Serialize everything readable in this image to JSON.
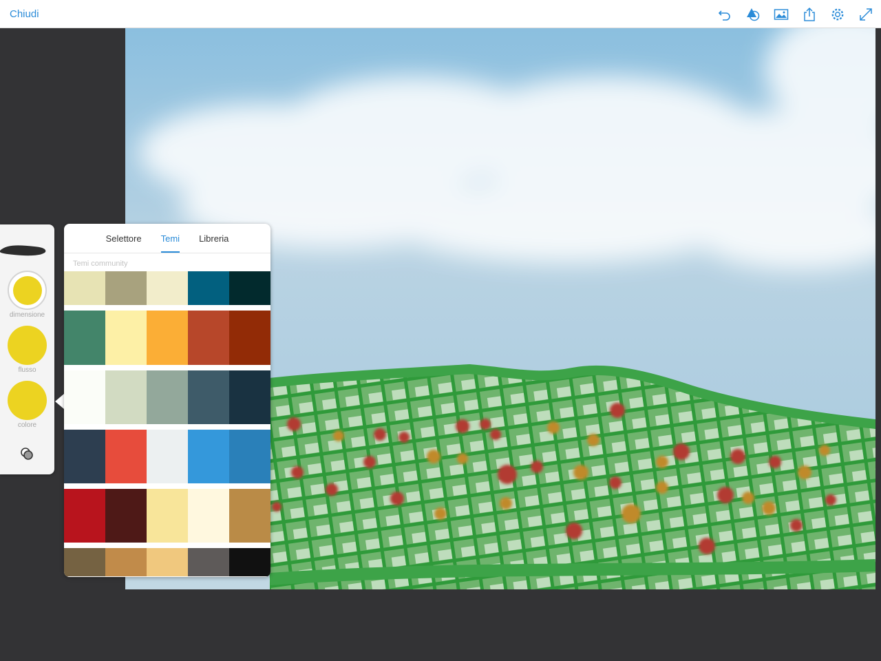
{
  "topbar": {
    "close_label": "Chiudi",
    "accent": "#2a8bd8",
    "tools": [
      "undo-icon",
      "shapes-icon",
      "image-icon",
      "share-icon",
      "settings-icon",
      "fullscreen-icon"
    ]
  },
  "brush": {
    "current_color": "#ecd321",
    "size_label": "dimensione",
    "flow_label": "flusso",
    "color_label": "colore",
    "layers_icon": "layers-icon"
  },
  "color_panel": {
    "tabs": [
      {
        "label": "Selettore",
        "active": false
      },
      {
        "label": "Temi",
        "active": true
      },
      {
        "label": "Libreria",
        "active": false
      }
    ],
    "section_label": "Temi community",
    "themes": [
      {
        "colors": [
          "#e7e3b4",
          "#a8a27e",
          "#f2edcb",
          "#02607f",
          "#022a2d"
        ]
      },
      {
        "colors": [
          "#43856a",
          "#fdf0a6",
          "#fbae36",
          "#b7472a",
          "#922b06"
        ]
      },
      {
        "colors": [
          "#fbfdf8",
          "#d2dbc2",
          "#93a89b",
          "#3e5b69",
          "#193241"
        ]
      },
      {
        "colors": [
          "#2d3e50",
          "#e74c3c",
          "#ecf0f1",
          "#3498db",
          "#2a80b9"
        ]
      },
      {
        "colors": [
          "#b8141d",
          "#4e1917",
          "#f8e59a",
          "#fff8df",
          "#ba8b47"
        ]
      },
      {
        "colors": [
          "#756242",
          "#c18b4a",
          "#f0c87e",
          "#5e5a59",
          "#111111"
        ]
      }
    ]
  }
}
